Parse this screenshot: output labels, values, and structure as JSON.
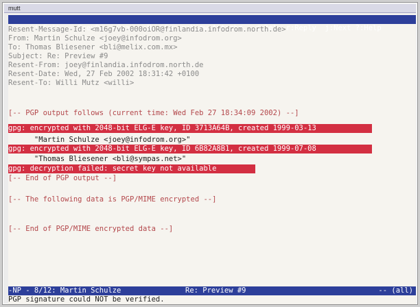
{
  "window": {
    "title": "mutt"
  },
  "help_bar": {
    "text": "i:Exit  -:PrevPg  <Space>:NextPg  v:View Attachm.  d:Del  r:Reply  j:Next ?:Help"
  },
  "headers": [
    "Resent-Message-Id: <m16g7vb-000oiOR@finlandia.infodrom.north.de>",
    "From: Martin Schulze <joey@infodrom.org>",
    "To: Thomas Bliesener <bli@melix.com.mx>",
    "Subject: Re: Preview #9",
    "Resent-From: joey@finlandia.infodrom.north.de",
    "Resent-Date: Wed, 27 Feb 2002 18:31:42 +0100",
    "Resent-To: Willi Mutz <willi>"
  ],
  "pgp_output": {
    "start": "[-- PGP output follows (current time: Wed Feb 27 18:34:09 2002) --]",
    "line1": "gpg: encrypted with 2048-bit ELG-E key, ID 3713A64B, created 1999-03-13",
    "name1": "      \"Martin Schulze <joey@infodrom.org>\"",
    "line2": "gpg: encrypted with 2048-bit ELG-E key, ID 6B82A8B1, created 1999-07-08",
    "name2": "      \"Thomas Bliesener <bli@sympas.net>\"",
    "failed": "gpg: decryption failed: secret key not available",
    "end": "[-- End of PGP output --]",
    "mime_start": "[-- The following data is PGP/MIME encrypted --]",
    "mime_end": "[-- End of PGP/MIME encrypted data --]"
  },
  "status_bar": {
    "left": "-NP - 8/12: Martin Schulze",
    "middle": "Re: Preview #9",
    "right": "-- (all)"
  },
  "message_line": "PGP signature could NOT be verified.",
  "colors": {
    "status_bar": "#2d3f9a",
    "gpg_highlight": "#d32f42",
    "pgp_text": "#b3474b",
    "header_text": "#8a8a8a"
  }
}
